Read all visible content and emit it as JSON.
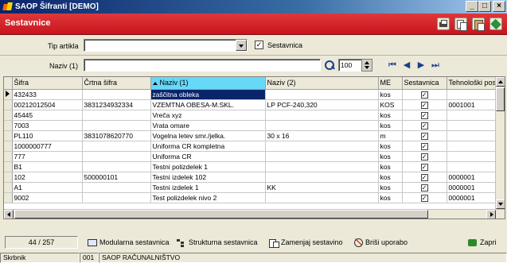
{
  "window": {
    "title": "SAOP Šifranti [DEMO]"
  },
  "header": {
    "title": "Sestavnice"
  },
  "filters": {
    "tip_artikla_label": "Tip artikla",
    "tip_artikla_value": "",
    "sestavnica_label": "Sestavnica",
    "sestavnica_checked": "✓",
    "naziv_label": "Naziv (1)",
    "naziv_value": "",
    "limit_value": "100"
  },
  "grid": {
    "columns": [
      "Šifra",
      "Črtna šifra",
      "Naziv (1)",
      "Naziv (2)",
      "ME",
      "Sestavnica",
      "Tehnološki pos"
    ],
    "sorted_column": 2,
    "selected_row": 0,
    "rows": [
      [
        "432433",
        "",
        "zaščitna obleka",
        "",
        "kos",
        "✓",
        ""
      ],
      [
        "00212012504",
        "3831234932334",
        "VZEMTNA OBESA-M.SKL.",
        "LP PCF-240,320",
        "KOS",
        "✓",
        "0001001"
      ],
      [
        "45445",
        "",
        "Vreča xyz",
        "",
        "kos",
        "✓",
        ""
      ],
      [
        "7003",
        "",
        "Vrata omare",
        "",
        "kos",
        "✓",
        ""
      ],
      [
        "PL110",
        "3831078620770",
        "Vogelna letev smr./jelka.",
        "30 x 16",
        "m",
        "✓",
        ""
      ],
      [
        "1000000777",
        "",
        "Uniforma CR kompletna",
        "",
        "kos",
        "✓",
        ""
      ],
      [
        "777",
        "",
        "Uniforma CR",
        "",
        "kos",
        "✓",
        ""
      ],
      [
        "B1",
        "",
        "Testni polizdelek 1",
        "",
        "kos",
        "✓",
        ""
      ],
      [
        "102",
        "500000101",
        "Testni izdelek 102",
        "",
        "kos",
        "✓",
        "0000001"
      ],
      [
        "A1",
        "",
        "Testni izdelek 1",
        "KK",
        "kos",
        "✓",
        "0000001"
      ],
      [
        "9002",
        "",
        "Test polizdelek nivo 2",
        "",
        "kos",
        "✓",
        "0000001"
      ]
    ]
  },
  "actions": {
    "counter": "44 / 257",
    "modularna": "Modularna sestavnica",
    "strukturna": "Strukturna sestavnica",
    "zamenjaj": "Zamenjaj sestavino",
    "brisi": "Briši uporabo",
    "zapri": "Zapri"
  },
  "status": {
    "user": "Skrbnik",
    "code": "001",
    "company": "SAOP RAČUNALNIŠTVO"
  }
}
